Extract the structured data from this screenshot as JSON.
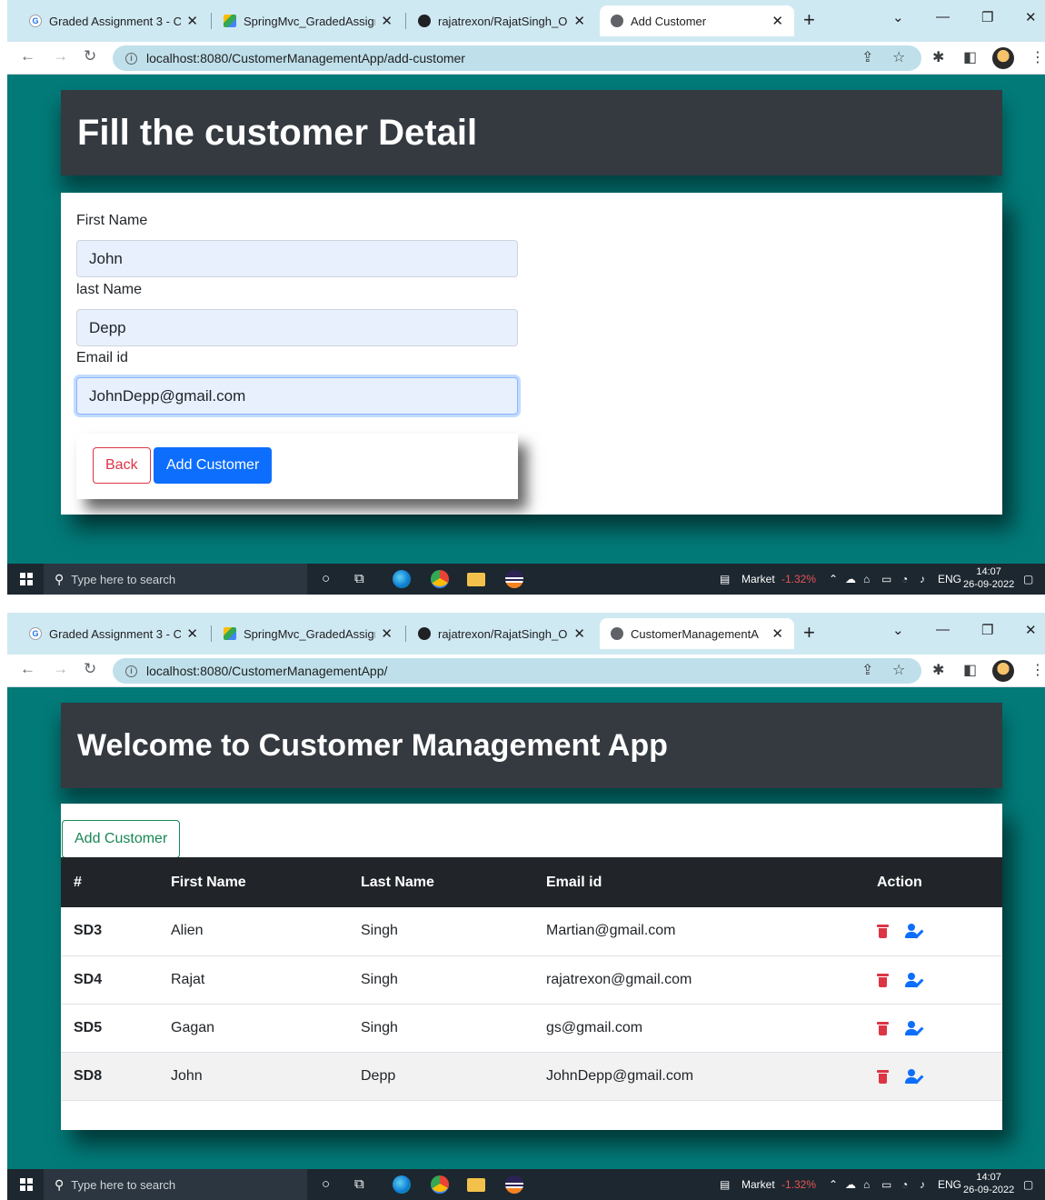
{
  "browser": {
    "tabs": [
      {
        "title": "Graded Assignment 3 - C",
        "favicon": "google-icon"
      },
      {
        "title": "SpringMvc_GradedAssign",
        "favicon": "drive-icon"
      },
      {
        "title": "rajatrexon/RajatSingh_OF",
        "favicon": "github-icon"
      }
    ],
    "close_glyph": "✕",
    "new_tab_glyph": "+"
  },
  "screen1": {
    "active_tab_title": "Add Customer",
    "url": "localhost:8080/CustomerManagementApp/add-customer",
    "heading": "Fill the customer Detail",
    "form": {
      "first_name_label": "First Name",
      "first_name_value": "John",
      "last_name_label": "last Name",
      "last_name_value": "Depp",
      "email_label": "Email id",
      "email_value": "JohnDepp@gmail.com"
    },
    "back_label": "Back",
    "submit_label": "Add Customer"
  },
  "screen2": {
    "active_tab_title": "CustomerManagementA",
    "url": "localhost:8080/CustomerManagementApp/",
    "heading": "Welcome to Customer Management App",
    "add_button_label": "Add Customer",
    "table": {
      "headers": [
        "#",
        "First Name",
        "Last Name",
        "Email id",
        "Action"
      ],
      "rows": [
        {
          "id": "SD3",
          "first": "Alien",
          "last": "Singh",
          "email": "Martian@gmail.com"
        },
        {
          "id": "SD4",
          "first": "Rajat",
          "last": "Singh",
          "email": "rajatrexon@gmail.com"
        },
        {
          "id": "SD5",
          "first": "Gagan",
          "last": "Singh",
          "email": "gs@gmail.com"
        },
        {
          "id": "SD8",
          "first": "John",
          "last": "Depp",
          "email": "JohnDepp@gmail.com"
        }
      ]
    }
  },
  "taskbar": {
    "search_placeholder": "Type here to search",
    "market_label": "Market",
    "market_change": "-1.32%",
    "language": "ENG",
    "time": "14:07",
    "date": "26-09-2022"
  },
  "colors": {
    "page_bg": "#027a78",
    "header_bg": "#343a40",
    "primary": "#0d6efd",
    "danger": "#dc3545",
    "success": "#198754"
  }
}
